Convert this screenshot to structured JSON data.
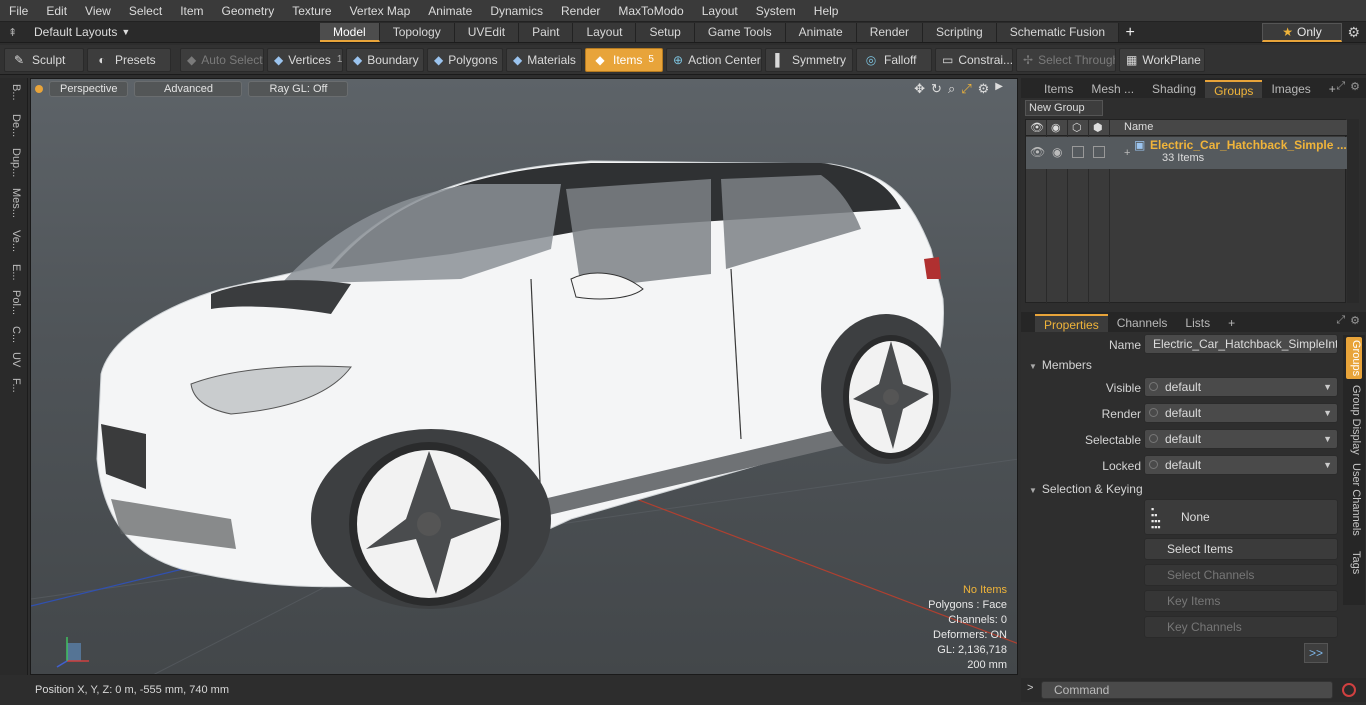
{
  "menu": [
    "File",
    "Edit",
    "View",
    "Select",
    "Item",
    "Geometry",
    "Texture",
    "Vertex Map",
    "Animate",
    "Dynamics",
    "Render",
    "MaxToModo",
    "Layout",
    "System",
    "Help"
  ],
  "layouts_label": "Default Layouts",
  "tabs": [
    "Model",
    "Topology",
    "UVEdit",
    "Paint",
    "Layout",
    "Setup",
    "Game Tools",
    "Animate",
    "Render",
    "Scripting",
    "Schematic Fusion"
  ],
  "active_tab": "Model",
  "only_label": "Only",
  "toolbar": {
    "sculpt": "Sculpt",
    "presets": "Presets",
    "auto_select": "Auto Select",
    "vertices": "Vertices",
    "vertices_count": "1",
    "boundary": "Boundary",
    "polygons": "Polygons",
    "materials": "Materials",
    "items": "Items",
    "items_count": "5",
    "action_center": "Action Center",
    "symmetry": "Symmetry",
    "falloff": "Falloff",
    "constraints": "Constrai...",
    "select_through": "Select Through",
    "workplane": "WorkPlane"
  },
  "left_tabs": [
    "B...",
    "De...",
    "Dup...",
    "Mes...",
    "Ve...",
    "E...",
    "Pol...",
    "C...",
    "UV",
    "F..."
  ],
  "viewport": {
    "perspective": "Perspective",
    "advanced": "Advanced",
    "raygl": "Ray GL: Off",
    "hud": {
      "no_items": "No Items",
      "polygons": "Polygons : Face",
      "channels": "Channels: 0",
      "deformers": "Deformers: ON",
      "gl": "GL: 2,136,718",
      "scale": "200 mm"
    }
  },
  "status": "Position X, Y, Z:   0 m, -555 mm, 740 mm",
  "panel_tabs_top": [
    "Items",
    "Mesh ...",
    "Shading",
    "Groups",
    "Images"
  ],
  "active_panel_tab_top": "Groups",
  "new_group": "New Group",
  "groups": {
    "name_header": "Name",
    "row_name": "Electric_Car_Hatchback_Simple ...",
    "row_count": "33 Items"
  },
  "panel_tabs_bottom": [
    "Properties",
    "Channels",
    "Lists"
  ],
  "active_panel_tab_bottom": "Properties",
  "properties": {
    "name_label": "Name",
    "name_value": "Electric_Car_Hatchback_SimpleInterio",
    "members_section": "Members",
    "visible_label": "Visible",
    "visible_value": "default",
    "render_label": "Render",
    "render_value": "default",
    "selectable_label": "Selectable",
    "selectable_value": "default",
    "locked_label": "Locked",
    "locked_value": "default",
    "selection_section": "Selection & Keying",
    "none_button": "None",
    "select_items": "Select Items",
    "select_channels": "Select Channels",
    "key_items": "Key Items",
    "key_channels": "Key Channels",
    "more": ">>"
  },
  "side_tabs": [
    "Groups",
    "Group Display",
    "User Channels",
    "Tags"
  ],
  "command_placeholder": "Command",
  "colors": {
    "accent": "#e8a43a"
  }
}
